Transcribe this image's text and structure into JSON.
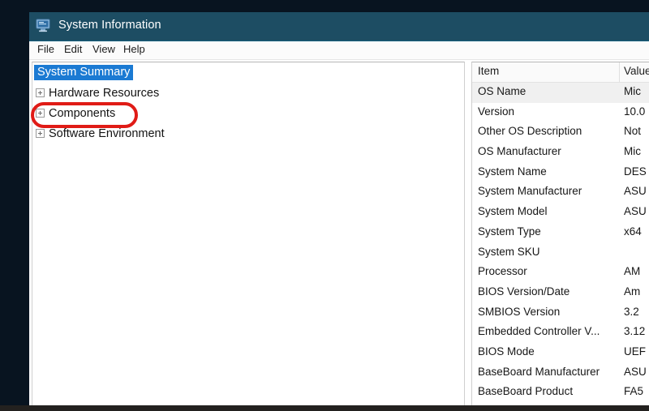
{
  "window": {
    "title": "System Information",
    "icon": "computer-monitor-icon"
  },
  "menu": {
    "items": [
      {
        "label": "File"
      },
      {
        "label": "Edit"
      },
      {
        "label": "View"
      },
      {
        "label": "Help"
      }
    ]
  },
  "tree": {
    "nodes": [
      {
        "label": "System Summary",
        "selected": true,
        "expandable": false
      },
      {
        "label": "Hardware Resources",
        "selected": false,
        "expandable": true
      },
      {
        "label": "Components",
        "selected": false,
        "expandable": true
      },
      {
        "label": "Software Environment",
        "selected": false,
        "expandable": true
      }
    ]
  },
  "details": {
    "columns": [
      "Item",
      "Value"
    ],
    "rows": [
      {
        "item": "OS Name",
        "value": "Mic",
        "selected": true
      },
      {
        "item": "Version",
        "value": "10.0",
        "selected": false
      },
      {
        "item": "Other OS Description",
        "value": "Not",
        "selected": false
      },
      {
        "item": "OS Manufacturer",
        "value": "Mic",
        "selected": false
      },
      {
        "item": "System Name",
        "value": "DES",
        "selected": false
      },
      {
        "item": "System Manufacturer",
        "value": "ASU",
        "selected": false
      },
      {
        "item": "System Model",
        "value": "ASU",
        "selected": false
      },
      {
        "item": "System Type",
        "value": "x64",
        "selected": false
      },
      {
        "item": "System SKU",
        "value": "",
        "selected": false
      },
      {
        "item": "Processor",
        "value": "AM",
        "selected": false
      },
      {
        "item": "BIOS Version/Date",
        "value": "Am",
        "selected": false
      },
      {
        "item": "SMBIOS Version",
        "value": "3.2",
        "selected": false
      },
      {
        "item": "Embedded Controller V...",
        "value": "3.12",
        "selected": false
      },
      {
        "item": "BIOS Mode",
        "value": "UEF",
        "selected": false
      },
      {
        "item": "BaseBoard Manufacturer",
        "value": "ASU",
        "selected": false
      },
      {
        "item": "BaseBoard Product",
        "value": "FA5",
        "selected": false
      }
    ]
  },
  "annotation": {
    "target": "Components",
    "color": "#e01b16"
  },
  "colors": {
    "titlebar": "#1d4d63",
    "tree_selection": "#1b7ad3",
    "row_selection": "#f0f0f0",
    "annotation": "#e01b16"
  }
}
